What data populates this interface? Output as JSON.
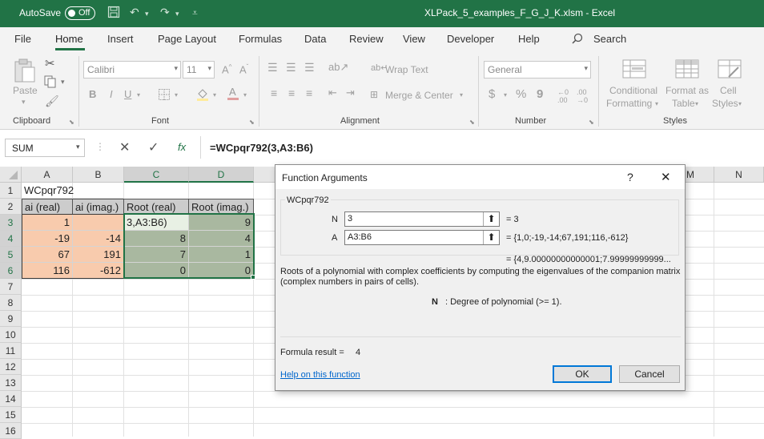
{
  "titlebar": {
    "autosave_label": "AutoSave",
    "autosave_state": "Off",
    "document_title": "XLPack_5_examples_F_G_J_K.xlsm  -  Excel"
  },
  "menu": {
    "tabs": [
      "File",
      "Home",
      "Insert",
      "Page Layout",
      "Formulas",
      "Data",
      "Review",
      "View",
      "Developer",
      "Help"
    ],
    "search_label": "Search"
  },
  "ribbon": {
    "clipboard": {
      "paste": "Paste",
      "label": "Clipboard"
    },
    "font": {
      "name": "Calibri",
      "size": "11",
      "label": "Font",
      "bold": "B",
      "italic": "I",
      "underline": "U"
    },
    "alignment": {
      "wrap_text": "Wrap Text",
      "merge_center": "Merge & Center",
      "label": "Alignment"
    },
    "number": {
      "format": "General",
      "currency": "$",
      "percent": "%",
      "comma": "9",
      "label": "Number"
    },
    "styles": {
      "conditional": "Conditional",
      "formatting": "Formatting",
      "format_as": "Format as",
      "table": "Table",
      "cell": "Cell",
      "cell_styles": "Styles",
      "label": "Styles"
    }
  },
  "formula_bar": {
    "name_box": "SUM",
    "fx": "fx",
    "formula": "=WCpqr792(3,A3:B6)"
  },
  "columns": [
    "A",
    "B",
    "C",
    "D",
    "",
    "",
    "",
    "",
    "",
    "M",
    "N"
  ],
  "rows": [
    "1",
    "2",
    "3",
    "4",
    "5",
    "6",
    "7",
    "8",
    "9",
    "10",
    "11",
    "12",
    "13",
    "14",
    "15",
    "16"
  ],
  "sheet": {
    "title": "WCpqr792",
    "headers": [
      "ai (real)",
      "ai (imag.)",
      "Root (real)",
      "Root (imag.)"
    ],
    "data": [
      [
        "1",
        "",
        "3,A3:B6)",
        "9"
      ],
      [
        "-19",
        "-14",
        "8",
        "4"
      ],
      [
        "67",
        "191",
        "7",
        "1"
      ],
      [
        "116",
        "-612",
        "0",
        "0"
      ]
    ]
  },
  "dialog": {
    "title": "Function Arguments",
    "help_glyph": "?",
    "close_glyph": "✕",
    "function_name": "WCpqr792",
    "args": [
      {
        "label": "N",
        "value": "3",
        "result": "=  3"
      },
      {
        "label": "A",
        "value": "A3:B6",
        "result": "=  {1,0;-19,-14;67,191;116,-612}"
      }
    ],
    "overall_result": "=  {4,9.00000000000001;7.99999999999...",
    "description": "Roots of a polynomial with complex coefficients by computing the eigenvalues of the companion matrix (complex numbers in pairs of cells).",
    "arg_help_name": "N",
    "arg_help_text": ": Degree of polynomial (>= 1).",
    "formula_result_label": "Formula result =",
    "formula_result_value": "4",
    "help_link": "Help on this function",
    "ok_label": "OK",
    "cancel_label": "Cancel"
  },
  "colors": {
    "excel_green": "#217346",
    "input_fill": "#f8cbad",
    "output_fill": "#a9b8a0",
    "ribbon_bg": "#f3f3f3",
    "link": "#0066cc"
  }
}
